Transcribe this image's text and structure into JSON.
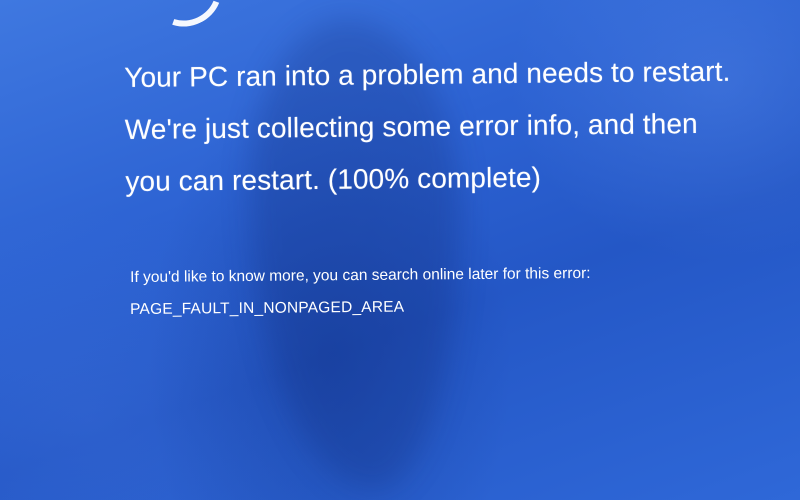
{
  "bsod": {
    "message": "Your PC ran into a problem and needs to restart. We're just collecting some error info, and then you can restart. (100% complete)",
    "info": "If you'd like to know more, you can search online later for this error:",
    "error_code": "PAGE_FAULT_IN_NONPAGED_AREA",
    "progress_percent": 100
  },
  "colors": {
    "background": "#2d63d3",
    "text": "#ffffff"
  },
  "icons": {
    "sad_face": "sad-face-icon"
  }
}
